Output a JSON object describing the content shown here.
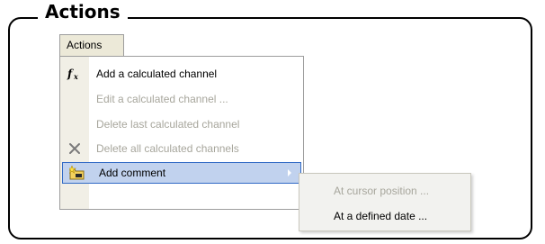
{
  "section": {
    "title": "Actions"
  },
  "menubar": {
    "actions_label": "Actions"
  },
  "menu": {
    "items": [
      {
        "label": "Add a calculated channel",
        "enabled": true,
        "icon": "function-icon"
      },
      {
        "label": "Edit a calculated channel ...",
        "enabled": false
      },
      {
        "label": "Delete last calculated channel",
        "enabled": false
      },
      {
        "label": "Delete all calculated channels",
        "enabled": false,
        "icon": "delete-x-icon"
      },
      {
        "label": "Add comment",
        "enabled": true,
        "icon": "add-comment-folder-icon",
        "has_submenu": true,
        "highlighted": true
      }
    ]
  },
  "submenu": {
    "items": [
      {
        "label": "At cursor position ...",
        "enabled": false
      },
      {
        "label": "At a defined date ...",
        "enabled": true
      }
    ]
  },
  "colors": {
    "highlight_bg": "#c1d2ee",
    "highlight_border": "#316ac5",
    "disabled_text": "#a7a69c",
    "gutter": "#f1efe6"
  }
}
